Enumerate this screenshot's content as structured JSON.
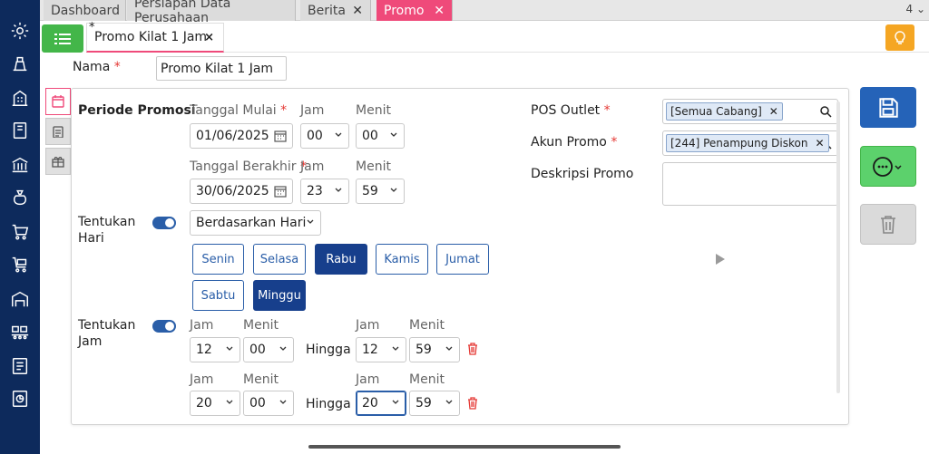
{
  "colors": {
    "nav": "#0d2a5c",
    "accent_pink": "#ef4a7a",
    "primary": "#2563b8",
    "success": "#43b649",
    "warning": "#f5a623",
    "danger": "#e53935"
  },
  "left_nav": {
    "icons": [
      "gear-icon",
      "scale-icon",
      "building-icon",
      "book-icon",
      "bank-icon",
      "money-bag-icon",
      "cart-icon",
      "cart-delivery-icon",
      "warehouse-icon",
      "conveyor-icon",
      "tax-report-icon",
      "pie-report-icon"
    ]
  },
  "tabs": [
    {
      "label": "Dashboard",
      "closable": false,
      "active": false
    },
    {
      "label": "Persiapan Data Perusahaan",
      "closable": false,
      "active": false
    },
    {
      "label": "Berita",
      "closable": true,
      "active": false
    },
    {
      "label": "Promo",
      "closable": true,
      "active": true
    }
  ],
  "tab_count": "4",
  "subtab": {
    "star": "*",
    "label": "Promo Kilat 1 Jam",
    "close": "×"
  },
  "form": {
    "nama_label": "Nama",
    "nama_value": "Promo Kilat 1 Jam",
    "required_mark": "*",
    "periode_label": "Periode Promosi",
    "tanggal_mulai_label": "Tanggal Mulai",
    "tanggal_mulai_value": "01/06/2025",
    "tanggal_berakhir_label": "Tanggal Berakhir",
    "tanggal_berakhir_value": "30/06/2025",
    "jam_label": "Jam",
    "menit_label": "Menit",
    "mulai_jam": "00",
    "mulai_menit": "00",
    "akhir_jam": "23",
    "akhir_menit": "59",
    "tentukan_hari_label": "Tentukan Hari",
    "hari_mode": "Berdasarkan Hari",
    "days": [
      {
        "label": "Senin",
        "selected": false
      },
      {
        "label": "Selasa",
        "selected": false
      },
      {
        "label": "Rabu",
        "selected": true
      },
      {
        "label": "Kamis",
        "selected": false
      },
      {
        "label": "Jumat",
        "selected": false
      },
      {
        "label": "Sabtu",
        "selected": false
      },
      {
        "label": "Minggu",
        "selected": true
      }
    ],
    "tentukan_jam_label": "Tentukan Jam",
    "hingga_label": "Hingga",
    "time_ranges": [
      {
        "from_jam": "12",
        "from_menit": "00",
        "to_jam": "12",
        "to_menit": "59"
      },
      {
        "from_jam": "20",
        "from_menit": "00",
        "to_jam": "20",
        "to_menit": "59"
      }
    ],
    "pos_outlet_label": "POS Outlet",
    "pos_outlet_chip": "[Semua Cabang]",
    "akun_promo_label": "Akun Promo",
    "akun_promo_chip": "[244] Penampung Diskon",
    "deskripsi_label": "Deskripsi Promo",
    "deskripsi_value": ""
  }
}
